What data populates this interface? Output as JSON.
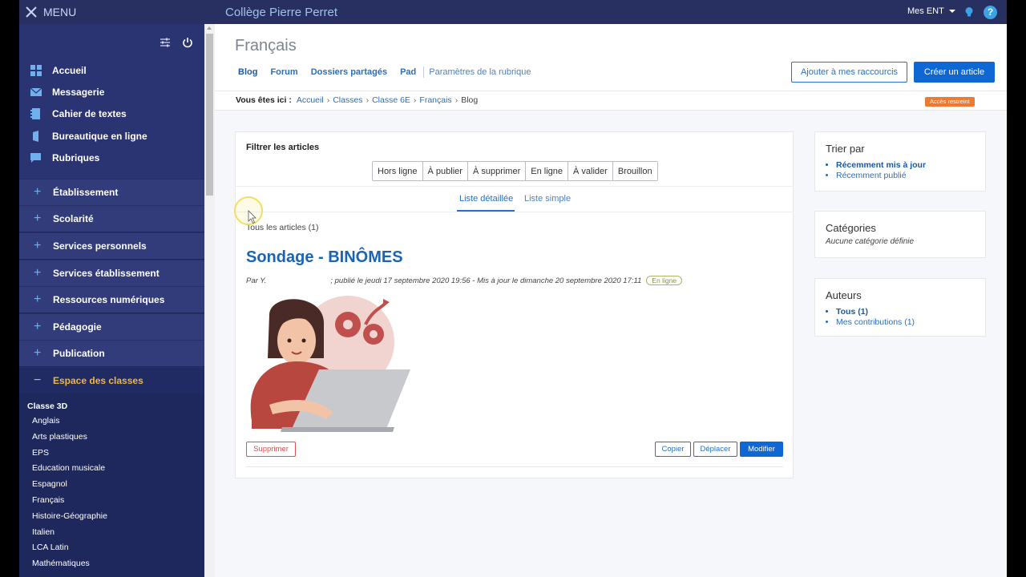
{
  "topbar": {
    "menu_label": "MENU",
    "site_title": "Collège Pierre Perret",
    "mes_ent": "Mes ENT",
    "help_glyph": "?"
  },
  "sidebar": {
    "main_items": [
      {
        "label": "Accueil",
        "icon": "grid-icon"
      },
      {
        "label": "Messagerie",
        "icon": "mail-icon"
      },
      {
        "label": "Cahier de textes",
        "icon": "notebook-icon"
      },
      {
        "label": "Bureautique en ligne",
        "icon": "office-icon"
      },
      {
        "label": "Rubriques",
        "icon": "chat-icon"
      }
    ],
    "groups": [
      {
        "label": "Établissement",
        "sign": "+"
      },
      {
        "label": "Scolarité",
        "sign": "+"
      },
      {
        "label": "Services personnels",
        "sign": "+"
      },
      {
        "label": "Services établissement",
        "sign": "+"
      },
      {
        "label": "Ressources numériques",
        "sign": "+"
      },
      {
        "label": "Pédagogie",
        "sign": "+"
      },
      {
        "label": "Publication",
        "sign": "+"
      },
      {
        "label": "Espace des classes",
        "sign": "−"
      }
    ],
    "class_title": "Classe 3D",
    "classes": [
      "Anglais",
      "Arts plastiques",
      "EPS",
      "Education musicale",
      "Espagnol",
      "Français",
      "Histoire-Géographie",
      "Italien",
      "LCA Latin",
      "Mathématiques"
    ]
  },
  "header": {
    "page_title": "Français",
    "tabs": [
      "Blog",
      "Forum",
      "Dossiers partagés",
      "Pad"
    ],
    "params_tab": "Paramètres de la rubrique",
    "shortcut_button": "Ajouter à mes raccourcis",
    "create_button": "Créer un article"
  },
  "breadcrumb": {
    "prefix": "Vous êtes ici :",
    "links": [
      "Accueil",
      "Classes",
      "Classe 6E",
      "Français"
    ],
    "current": "Blog",
    "access_badge": "Accès restreint"
  },
  "filter": {
    "label": "Filtrer les articles",
    "buttons": [
      "Hors ligne",
      "À publier",
      "À supprimer",
      "En ligne",
      "À valider",
      "Brouillon"
    ],
    "view_tabs": [
      "Liste détaillée",
      "Liste simple"
    ],
    "all_articles": "Tous les articles (1)"
  },
  "article": {
    "title": "Sondage - BINÔMES",
    "meta_by": "Par Y.",
    "meta_rest": "; publié le jeudi 17 septembre 2020 19:56 - Mis à jour le dimanche 20 septembre 2020 17:11",
    "status": "En ligne",
    "delete_button": "Supprimer",
    "copy_button": "Copier",
    "move_button": "Déplacer",
    "edit_button": "Modifier"
  },
  "widgets": {
    "sort": {
      "title": "Trier par",
      "items": [
        "Récemment mis à jour",
        "Récemment publié"
      ]
    },
    "categories": {
      "title": "Catégories",
      "empty": "Aucune catégorie définie"
    },
    "authors": {
      "title": "Auteurs",
      "items": [
        "Tous (1)",
        "Mes contributions (1)"
      ]
    }
  },
  "colors": {
    "topbar": "#273060",
    "sidebar": "#1f285d",
    "accent": "#0f67d3",
    "active_group": "#f0b73a",
    "badge_orange": "#ee7a2f"
  }
}
